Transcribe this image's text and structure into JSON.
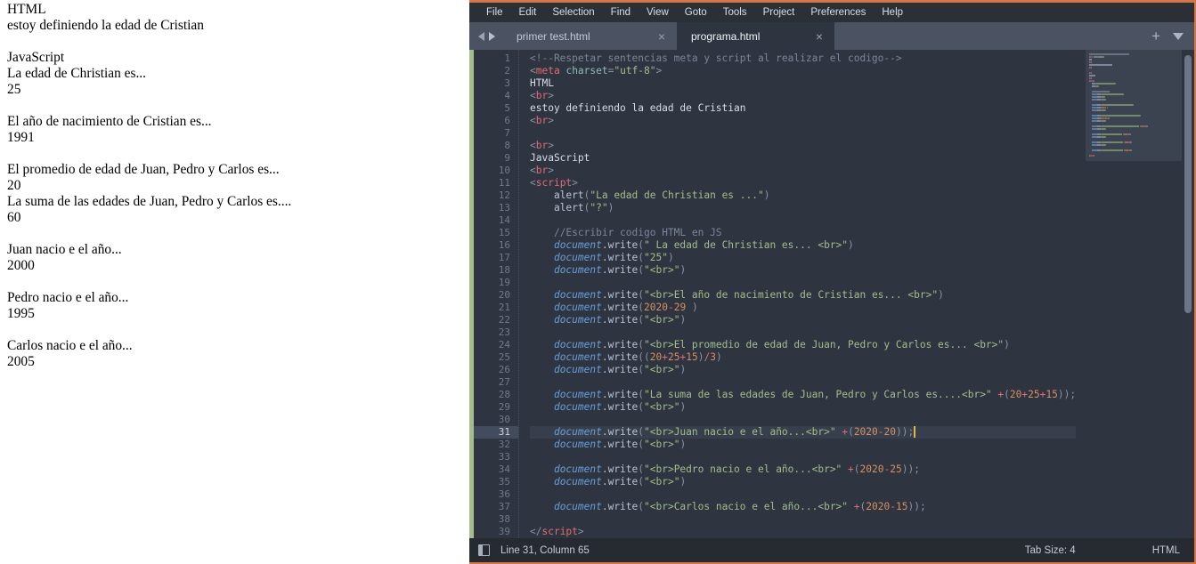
{
  "browser_output": {
    "lines": [
      {
        "text": "HTML",
        "gap_before": false
      },
      {
        "text": "estoy definiendo la edad de Cristian",
        "gap_before": false
      },
      {
        "text": "JavaScript",
        "gap_before": true
      },
      {
        "text": "La edad de Christian es...",
        "gap_before": false
      },
      {
        "text": "25",
        "gap_before": false
      },
      {
        "text": "El año de nacimiento de Cristian es...",
        "gap_before": true
      },
      {
        "text": "1991",
        "gap_before": false
      },
      {
        "text": "El promedio de edad de Juan, Pedro y Carlos es...",
        "gap_before": true
      },
      {
        "text": "20",
        "gap_before": false
      },
      {
        "text": "La suma de las edades de Juan, Pedro y Carlos es....",
        "gap_before": false
      },
      {
        "text": "60",
        "gap_before": false
      },
      {
        "text": "Juan nacio e el año...",
        "gap_before": true
      },
      {
        "text": "2000",
        "gap_before": false
      },
      {
        "text": "Pedro nacio e el año...",
        "gap_before": true
      },
      {
        "text": "1995",
        "gap_before": false
      },
      {
        "text": "Carlos nacio e el año...",
        "gap_before": true
      },
      {
        "text": "2005",
        "gap_before": false
      }
    ]
  },
  "editor": {
    "menu": [
      "File",
      "Edit",
      "Selection",
      "Find",
      "View",
      "Goto",
      "Tools",
      "Project",
      "Preferences",
      "Help"
    ],
    "tab_nav": {
      "prev_icon": "arrow-left-icon",
      "next_icon": "arrow-right-icon"
    },
    "tabs": [
      {
        "label": "primer test.html",
        "active": false,
        "close_glyph": "×"
      },
      {
        "label": "programa.html",
        "active": true,
        "close_glyph": "×"
      }
    ],
    "tabbar_actions": {
      "new_tab_glyph": "+",
      "dropdown_icon": "chevron-down-icon"
    },
    "current_line": 31,
    "caret": {
      "line": 31,
      "column": 65
    },
    "code_lines": [
      {
        "n": 1,
        "tokens": [
          [
            "c-com",
            "<!--Respetar sentencias meta y script al realizar el codigo-->"
          ]
        ]
      },
      {
        "n": 2,
        "tokens": [
          [
            "c-pun",
            "<"
          ],
          [
            "c-tag",
            "meta"
          ],
          [
            "c-txt",
            " "
          ],
          [
            "c-attr",
            "charset"
          ],
          [
            "c-pun",
            "="
          ],
          [
            "c-str",
            "\"utf-8\""
          ],
          [
            "c-pun",
            ">"
          ]
        ]
      },
      {
        "n": 3,
        "tokens": [
          [
            "c-txt",
            "HTML"
          ]
        ]
      },
      {
        "n": 4,
        "tokens": [
          [
            "c-pun",
            "<"
          ],
          [
            "c-tag",
            "br"
          ],
          [
            "c-pun",
            ">"
          ]
        ]
      },
      {
        "n": 5,
        "tokens": [
          [
            "c-txt",
            "estoy definiendo la edad de Cristian"
          ]
        ]
      },
      {
        "n": 6,
        "tokens": [
          [
            "c-pun",
            "<"
          ],
          [
            "c-tag",
            "br"
          ],
          [
            "c-pun",
            ">"
          ]
        ]
      },
      {
        "n": 7,
        "tokens": []
      },
      {
        "n": 8,
        "tokens": [
          [
            "c-pun",
            "<"
          ],
          [
            "c-tag",
            "br"
          ],
          [
            "c-pun",
            ">"
          ]
        ]
      },
      {
        "n": 9,
        "tokens": [
          [
            "c-txt",
            "JavaScript"
          ]
        ]
      },
      {
        "n": 10,
        "tokens": [
          [
            "c-pun",
            "<"
          ],
          [
            "c-tag",
            "br"
          ],
          [
            "c-pun",
            ">"
          ]
        ]
      },
      {
        "n": 11,
        "tokens": [
          [
            "c-pun",
            "<"
          ],
          [
            "c-tag",
            "script"
          ],
          [
            "c-pun",
            ">"
          ]
        ]
      },
      {
        "n": 12,
        "tokens": [
          [
            "c-txt",
            "    "
          ],
          [
            "c-fn",
            "alert"
          ],
          [
            "c-pun",
            "("
          ],
          [
            "c-str",
            "\"La edad de Christian es ...\""
          ],
          [
            "c-pun",
            ")"
          ]
        ]
      },
      {
        "n": 13,
        "tokens": [
          [
            "c-txt",
            "    "
          ],
          [
            "c-fn",
            "alert"
          ],
          [
            "c-pun",
            "("
          ],
          [
            "c-str",
            "\"?\""
          ],
          [
            "c-pun",
            ")"
          ]
        ]
      },
      {
        "n": 14,
        "tokens": []
      },
      {
        "n": 15,
        "tokens": [
          [
            "c-txt",
            "    "
          ],
          [
            "c-com",
            "//Escribir codigo HTML en JS"
          ]
        ]
      },
      {
        "n": 16,
        "tokens": [
          [
            "c-txt",
            "    "
          ],
          [
            "c-obj",
            "document"
          ],
          [
            "c-fn",
            ".write"
          ],
          [
            "c-pun",
            "("
          ],
          [
            "c-str",
            "\" La edad de Christian es... <br>\""
          ],
          [
            "c-pun",
            ")"
          ]
        ]
      },
      {
        "n": 17,
        "tokens": [
          [
            "c-txt",
            "    "
          ],
          [
            "c-obj",
            "document"
          ],
          [
            "c-fn",
            ".write"
          ],
          [
            "c-pun",
            "("
          ],
          [
            "c-str",
            "\"25\""
          ],
          [
            "c-pun",
            ")"
          ]
        ]
      },
      {
        "n": 18,
        "tokens": [
          [
            "c-txt",
            "    "
          ],
          [
            "c-obj",
            "document"
          ],
          [
            "c-fn",
            ".write"
          ],
          [
            "c-pun",
            "("
          ],
          [
            "c-str",
            "\"<br>\""
          ],
          [
            "c-pun",
            ")"
          ]
        ]
      },
      {
        "n": 19,
        "tokens": []
      },
      {
        "n": 20,
        "tokens": [
          [
            "c-txt",
            "    "
          ],
          [
            "c-obj",
            "document"
          ],
          [
            "c-fn",
            ".write"
          ],
          [
            "c-pun",
            "("
          ],
          [
            "c-str",
            "\"<br>El año de nacimiento de Cristian es... <br>\""
          ],
          [
            "c-pun",
            ")"
          ]
        ]
      },
      {
        "n": 21,
        "tokens": [
          [
            "c-txt",
            "    "
          ],
          [
            "c-obj",
            "document"
          ],
          [
            "c-fn",
            ".write"
          ],
          [
            "c-pun",
            "("
          ],
          [
            "c-num",
            "2020"
          ],
          [
            "c-op",
            "-"
          ],
          [
            "c-num",
            "29"
          ],
          [
            "c-txt",
            " "
          ],
          [
            "c-pun",
            ")"
          ]
        ]
      },
      {
        "n": 22,
        "tokens": [
          [
            "c-txt",
            "    "
          ],
          [
            "c-obj",
            "document"
          ],
          [
            "c-fn",
            ".write"
          ],
          [
            "c-pun",
            "("
          ],
          [
            "c-str",
            "\"<br>\""
          ],
          [
            "c-pun",
            ")"
          ]
        ]
      },
      {
        "n": 23,
        "tokens": []
      },
      {
        "n": 24,
        "tokens": [
          [
            "c-txt",
            "    "
          ],
          [
            "c-obj",
            "document"
          ],
          [
            "c-fn",
            ".write"
          ],
          [
            "c-pun",
            "("
          ],
          [
            "c-str",
            "\"<br>El promedio de edad de Juan, Pedro y Carlos es... <br>\""
          ],
          [
            "c-pun",
            ")"
          ]
        ]
      },
      {
        "n": 25,
        "tokens": [
          [
            "c-txt",
            "    "
          ],
          [
            "c-obj",
            "document"
          ],
          [
            "c-fn",
            ".write"
          ],
          [
            "c-pun",
            "(("
          ],
          [
            "c-num",
            "20"
          ],
          [
            "c-op",
            "+"
          ],
          [
            "c-num",
            "25"
          ],
          [
            "c-op",
            "+"
          ],
          [
            "c-num",
            "15"
          ],
          [
            "c-pun",
            ")"
          ],
          [
            "c-op",
            "/"
          ],
          [
            "c-num",
            "3"
          ],
          [
            "c-pun",
            ")"
          ]
        ]
      },
      {
        "n": 26,
        "tokens": [
          [
            "c-txt",
            "    "
          ],
          [
            "c-obj",
            "document"
          ],
          [
            "c-fn",
            ".write"
          ],
          [
            "c-pun",
            "("
          ],
          [
            "c-str",
            "\"<br>\""
          ],
          [
            "c-pun",
            ")"
          ]
        ]
      },
      {
        "n": 27,
        "tokens": []
      },
      {
        "n": 28,
        "tokens": [
          [
            "c-txt",
            "    "
          ],
          [
            "c-obj",
            "document"
          ],
          [
            "c-fn",
            ".write"
          ],
          [
            "c-pun",
            "("
          ],
          [
            "c-str",
            "\"La suma de las edades de Juan, Pedro y Carlos es....<br>\""
          ],
          [
            "c-txt",
            " "
          ],
          [
            "c-op",
            "+"
          ],
          [
            "c-pun",
            "("
          ],
          [
            "c-num",
            "20"
          ],
          [
            "c-op",
            "+"
          ],
          [
            "c-num",
            "25"
          ],
          [
            "c-op",
            "+"
          ],
          [
            "c-num",
            "15"
          ],
          [
            "c-pun",
            "))"
          ],
          [
            "c-semi",
            ";"
          ]
        ]
      },
      {
        "n": 29,
        "tokens": [
          [
            "c-txt",
            "    "
          ],
          [
            "c-obj",
            "document"
          ],
          [
            "c-fn",
            ".write"
          ],
          [
            "c-pun",
            "("
          ],
          [
            "c-str",
            "\"<br>\""
          ],
          [
            "c-pun",
            ")"
          ]
        ]
      },
      {
        "n": 30,
        "tokens": []
      },
      {
        "n": 31,
        "tokens": [
          [
            "c-txt",
            "    "
          ],
          [
            "c-obj",
            "document"
          ],
          [
            "c-fn",
            ".write"
          ],
          [
            "c-pun",
            "("
          ],
          [
            "c-str",
            "\"<br>Juan nacio e el año...<br>\""
          ],
          [
            "c-txt",
            " "
          ],
          [
            "c-op",
            "+"
          ],
          [
            "c-pun",
            "("
          ],
          [
            "c-num",
            "2020"
          ],
          [
            "c-op",
            "-"
          ],
          [
            "c-num",
            "20"
          ],
          [
            "c-pun",
            "))"
          ],
          [
            "c-semi",
            ";"
          ]
        ]
      },
      {
        "n": 32,
        "tokens": [
          [
            "c-txt",
            "    "
          ],
          [
            "c-obj",
            "document"
          ],
          [
            "c-fn",
            ".write"
          ],
          [
            "c-pun",
            "("
          ],
          [
            "c-str",
            "\"<br>\""
          ],
          [
            "c-pun",
            ")"
          ]
        ]
      },
      {
        "n": 33,
        "tokens": []
      },
      {
        "n": 34,
        "tokens": [
          [
            "c-txt",
            "    "
          ],
          [
            "c-obj",
            "document"
          ],
          [
            "c-fn",
            ".write"
          ],
          [
            "c-pun",
            "("
          ],
          [
            "c-str",
            "\"<br>Pedro nacio e el año...<br>\""
          ],
          [
            "c-txt",
            " "
          ],
          [
            "c-op",
            "+"
          ],
          [
            "c-pun",
            "("
          ],
          [
            "c-num",
            "2020"
          ],
          [
            "c-op",
            "-"
          ],
          [
            "c-num",
            "25"
          ],
          [
            "c-pun",
            "))"
          ],
          [
            "c-semi",
            ";"
          ]
        ]
      },
      {
        "n": 35,
        "tokens": [
          [
            "c-txt",
            "    "
          ],
          [
            "c-obj",
            "document"
          ],
          [
            "c-fn",
            ".write"
          ],
          [
            "c-pun",
            "("
          ],
          [
            "c-str",
            "\"<br>\""
          ],
          [
            "c-pun",
            ")"
          ]
        ]
      },
      {
        "n": 36,
        "tokens": []
      },
      {
        "n": 37,
        "tokens": [
          [
            "c-txt",
            "    "
          ],
          [
            "c-obj",
            "document"
          ],
          [
            "c-fn",
            ".write"
          ],
          [
            "c-pun",
            "("
          ],
          [
            "c-str",
            "\"<br>Carlos nacio e el año...<br>\""
          ],
          [
            "c-txt",
            " "
          ],
          [
            "c-op",
            "+"
          ],
          [
            "c-pun",
            "("
          ],
          [
            "c-num",
            "2020"
          ],
          [
            "c-op",
            "-"
          ],
          [
            "c-num",
            "15"
          ],
          [
            "c-pun",
            "))"
          ],
          [
            "c-semi",
            ";"
          ]
        ]
      },
      {
        "n": 38,
        "tokens": []
      },
      {
        "n": 39,
        "tokens": [
          [
            "c-pun",
            "</"
          ],
          [
            "c-tag",
            "script"
          ],
          [
            "c-pun",
            ">"
          ]
        ]
      }
    ],
    "statusbar": {
      "sidebar_toggle_icon": "sidebar-toggle-icon",
      "position": "Line 31, Column 65",
      "tab_size": "Tab Size: 4",
      "syntax": "HTML"
    }
  },
  "colors": {
    "accent_border": "#d4764a",
    "editor_bg": "#2e3440",
    "tabbar_bg": "#4b5363",
    "menubar_bg": "#2b2f36",
    "statusbar_bg": "#262a31",
    "modified_marker": "#a3be8c",
    "string": "#a3be8c",
    "tag": "#e06c75",
    "number": "#d79060",
    "comment": "#7b8699",
    "object": "#6a9fdc",
    "caret": "#e8b24b"
  }
}
